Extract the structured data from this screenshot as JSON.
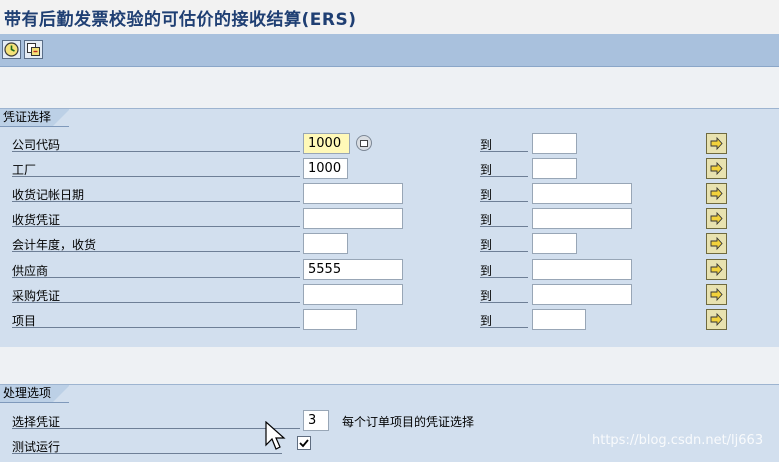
{
  "title": "带有后勤发票校验的可估价的接收结算(ERS)",
  "toolbar": {
    "buttons": [
      {
        "icon": "execute-clock-icon"
      },
      {
        "icon": "get-variant-icon"
      }
    ]
  },
  "selection": {
    "header": "凭证选择",
    "to_label": "到",
    "rows": [
      {
        "label": "公司代码",
        "from": "1000",
        "to": ""
      },
      {
        "label": "工厂",
        "from": "1000",
        "to": ""
      },
      {
        "label": "收货记帐日期",
        "from": "",
        "to": ""
      },
      {
        "label": "收货凭证",
        "from": "",
        "to": ""
      },
      {
        "label": "会计年度，收货",
        "from": "",
        "to": ""
      },
      {
        "label": "供应商",
        "from": "5555",
        "to": ""
      },
      {
        "label": "采购凭证",
        "from": "",
        "to": ""
      },
      {
        "label": "项目",
        "from": "",
        "to": ""
      }
    ]
  },
  "processing": {
    "header": "处理选项",
    "doc_select_label": "选择凭证",
    "doc_select_value": "3",
    "doc_select_note": "每个订单项目的凭证选择",
    "test_run_label": "测试运行",
    "test_run_checked": true
  },
  "watermark": "https://blog.csdn.net/lj663",
  "colors": {
    "toolbar": "#a9c1dd",
    "section": "#d2dfee",
    "required": "#fff9b8",
    "title": "#1f3f73"
  }
}
